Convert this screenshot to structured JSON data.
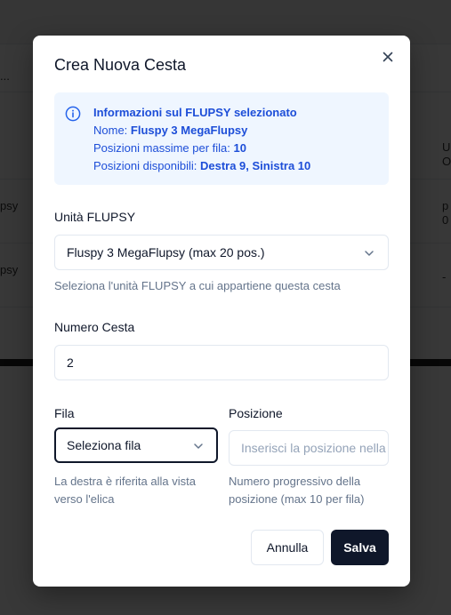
{
  "background": {
    "row1_text": "...",
    "row2_text": "psy",
    "row3_text": "psy",
    "right_col_top": "U\nO",
    "right_col_mid": "p\n0",
    "right_col_low": "-"
  },
  "modal": {
    "title": "Crea Nuova Cesta",
    "close_label": "×",
    "info": {
      "heading": "Informazioni sul FLUPSY selezionato",
      "name_label": "Nome:",
      "name_value": "Fluspy 3 MegaFlupsy",
      "max_label": "Posizioni massime per fila:",
      "max_value": "10",
      "avail_label": "Posizioni disponibili:",
      "avail_value": "Destra 9, Sinistra 10"
    },
    "flupsy": {
      "label": "Unità FLUPSY",
      "selected": "Fluspy 3 MegaFlupsy (max 20 pos.)",
      "help": "Seleziona l'unità FLUPSY a cui appartiene questa cesta"
    },
    "numero": {
      "label": "Numero Cesta",
      "value": "2"
    },
    "fila": {
      "label": "Fila",
      "selected": "Seleziona fila",
      "help_line1": "La destra è riferita alla vista",
      "help_line2": "verso l'elica"
    },
    "posizione": {
      "label": "Posizione",
      "placeholder": "Inserisci la posizione nella fila",
      "help_line1": "Numero progressivo della",
      "help_line2": "posizione (max 10 per fila)"
    },
    "buttons": {
      "cancel": "Annulla",
      "save": "Salva"
    }
  },
  "colors": {
    "accent": "#1d4ed8",
    "info_bg": "#eff6ff",
    "primary_button": "#0f172a"
  }
}
